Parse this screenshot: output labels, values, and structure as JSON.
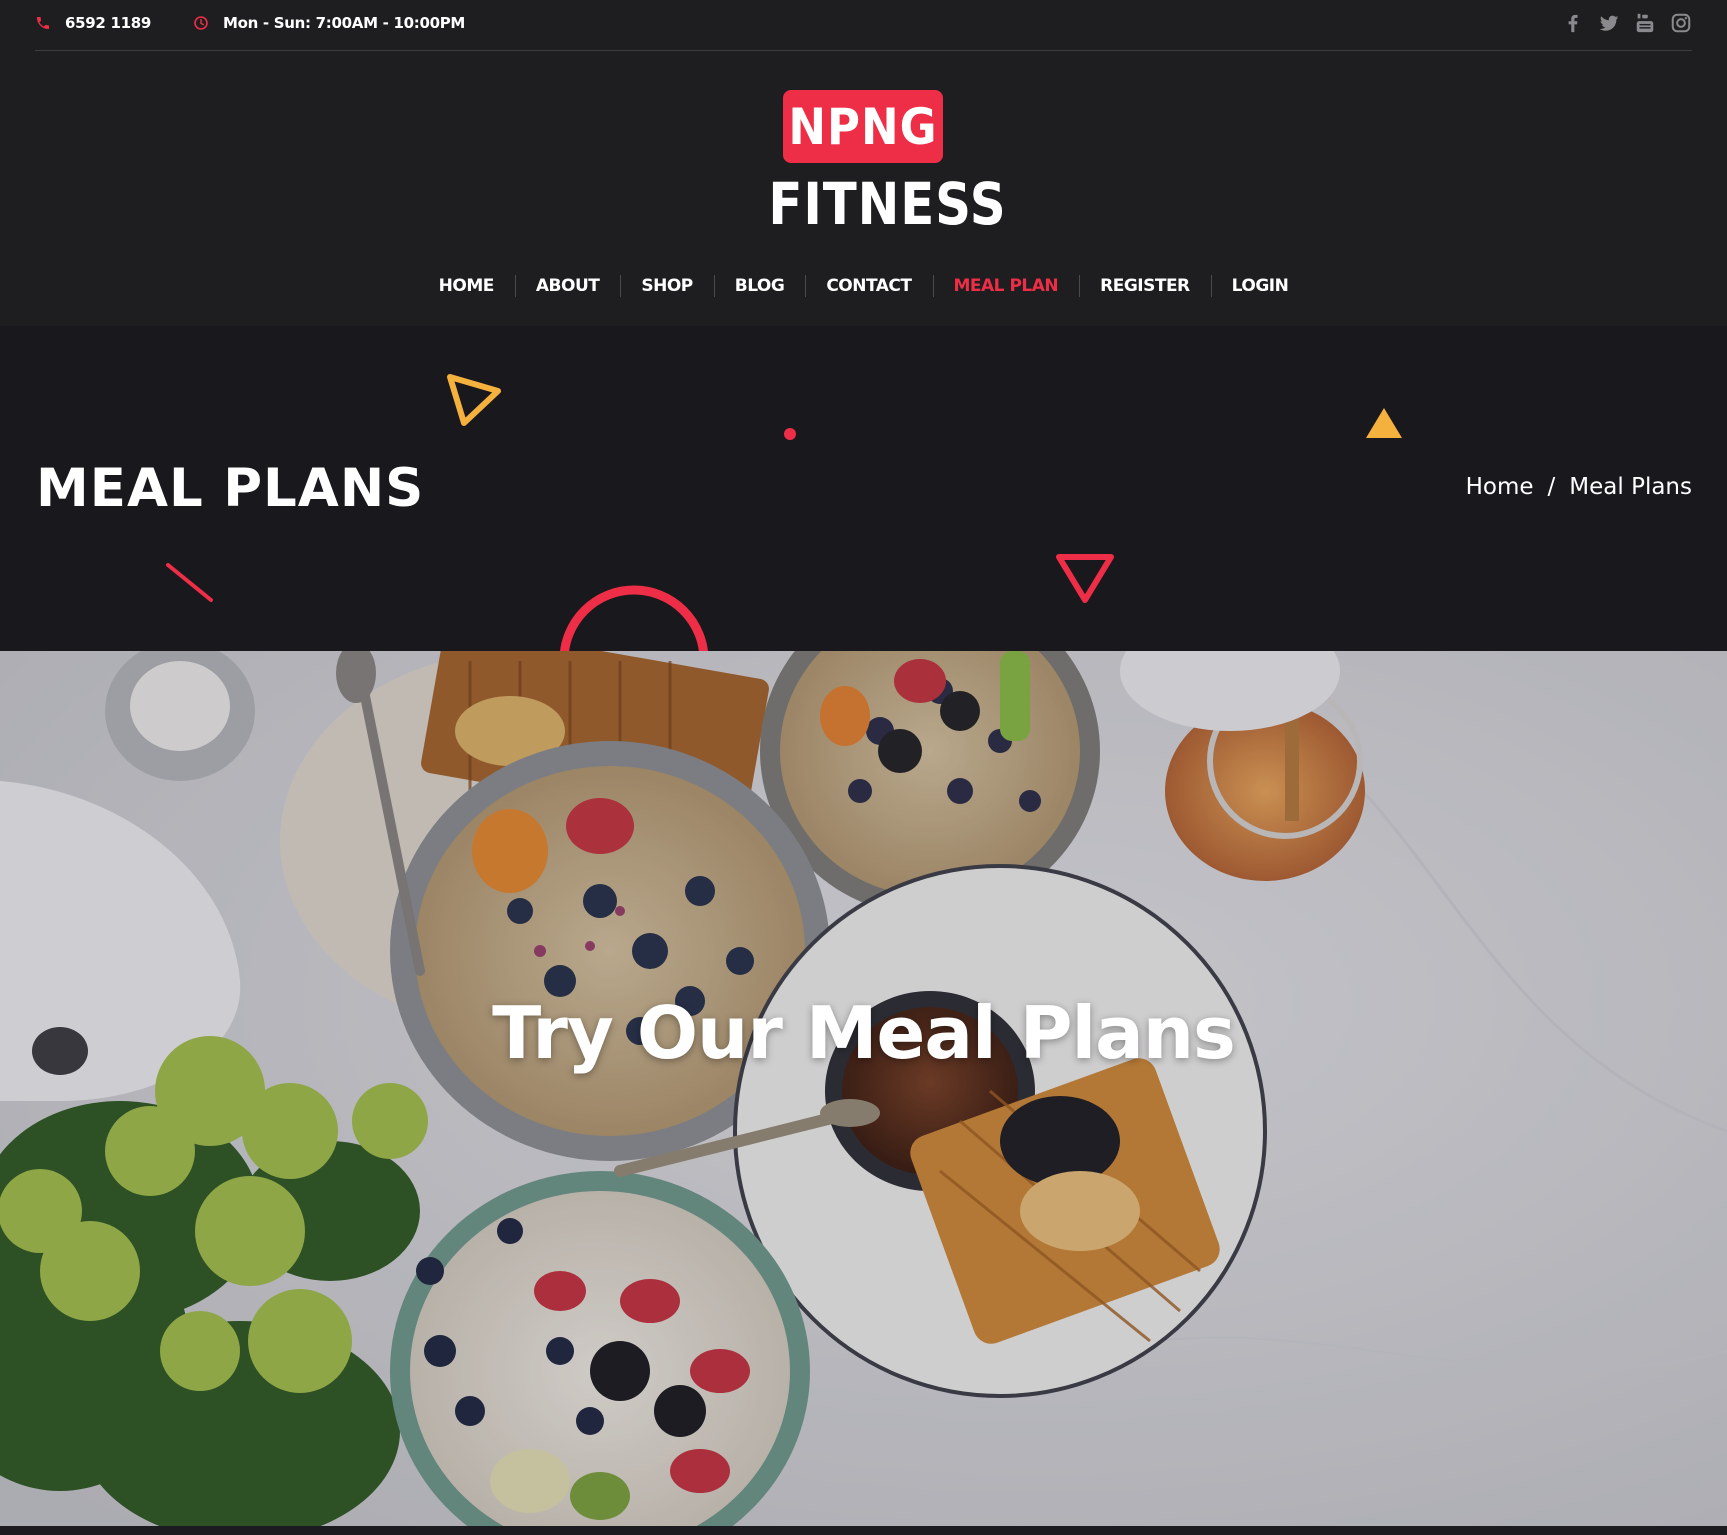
{
  "topbar": {
    "phone": "6592 1189",
    "hours": "Mon - Sun: 7:00AM - 10:00PM",
    "phone_icon": "phone-icon",
    "hours_icon": "clock-icon",
    "socials": [
      "facebook-icon",
      "twitter-icon",
      "youtube-icon",
      "instagram-icon"
    ]
  },
  "logo": {
    "badge": "NPNG",
    "word": "FITNESS"
  },
  "nav": {
    "items": [
      "HOME",
      "ABOUT",
      "SHOP",
      "BLOG",
      "CONTACT",
      "MEAL PLAN",
      "REGISTER",
      "LOGIN"
    ],
    "active": "MEAL PLAN"
  },
  "banner": {
    "title": "MEAL PLANS",
    "breadcrumb_home": "Home",
    "breadcrumb_sep": "/",
    "breadcrumb_current": "Meal Plans"
  },
  "hero": {
    "title": "Try Our Meal Plans"
  },
  "colors": {
    "accent": "#ee2e47",
    "yellow": "#f5b13d",
    "dark": "#1e1e20"
  }
}
